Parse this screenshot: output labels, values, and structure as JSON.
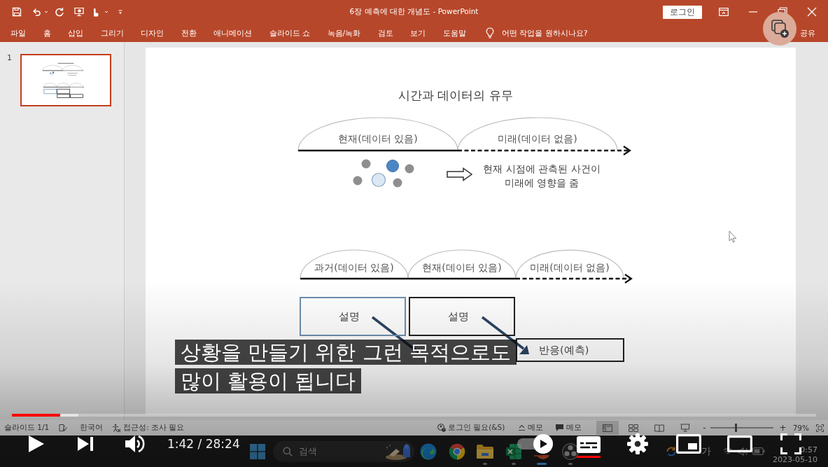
{
  "ppt": {
    "title": "6장 예측에 대한 개념도 - PowerPoint",
    "login_button": "로그인",
    "ribbon_tabs": [
      "파일",
      "홈",
      "삽입",
      "그리기",
      "디자인",
      "전환",
      "애니메이션",
      "슬라이드 쇼",
      "녹음/녹화",
      "검토",
      "보기",
      "도움말"
    ],
    "tell_me": "어떤 작업을 원하시나요?",
    "share": "공유",
    "thumbnails": [
      {
        "number": "1",
        "selected": true
      }
    ],
    "slide": {
      "title": "시간과 데이터의 유무",
      "timeline_top": {
        "segments": [
          {
            "label": "현재(데이터 있음)",
            "kind": "observed"
          },
          {
            "label": "미래(데이터 없음)",
            "kind": "future"
          }
        ],
        "note_lines": [
          "현재 시점에 관측된 사건이",
          "미래에 영향을 줌"
        ]
      },
      "timeline_bottom": {
        "segments": [
          {
            "label": "과거(데이터 있음)",
            "kind": "observed"
          },
          {
            "label": "현재(데이터 있음)",
            "kind": "observed"
          },
          {
            "label": "미래(데이터 없음)",
            "kind": "future"
          }
        ]
      },
      "explanation_boxes": [
        {
          "label": "설명",
          "kind": "highlighted"
        },
        {
          "label": "설명",
          "kind": "plain"
        }
      ],
      "response_box": "반응(예측)"
    },
    "status_bar": {
      "slide_counter": "슬라이드 1/1",
      "language": "한국어",
      "accessibility": "접근성: 조사 필요",
      "sign_in": "로그인 필요(&S)",
      "notes": "메모",
      "comments": "메모",
      "views": [
        {
          "kind": "normal",
          "selected": true
        },
        {
          "kind": "sorter",
          "selected": false
        },
        {
          "kind": "reading",
          "selected": false
        },
        {
          "kind": "show",
          "selected": false
        }
      ],
      "zoom_out": "-",
      "zoom_slider": {
        "level": 0.41
      },
      "zoom_in": "+",
      "zoom": "79%"
    }
  },
  "taskbar": {
    "search": {
      "placeholder": "검색"
    },
    "apps": [
      {
        "kind": "swirl",
        "running": false,
        "selected": false
      },
      {
        "kind": "wheel",
        "running": false,
        "selected": false
      },
      {
        "kind": "folder",
        "running": true,
        "selected": false
      },
      {
        "kind": "sheet",
        "running": true,
        "selected": false
      },
      {
        "kind": "slides",
        "running": true,
        "selected": true
      },
      {
        "kind": "aperture",
        "running": true,
        "selected": false
      }
    ],
    "ime": "가",
    "clock": "0:57",
    "date": "2023-05-10"
  },
  "subtitles": [
    "상황을 만들기 위한 그런 목적으로도",
    "많이 활용이 됩니다"
  ],
  "player": {
    "progress": {
      "level": 0.06
    },
    "buffer": {
      "level": 0.083
    },
    "time": "1:42 / 28:24",
    "autoplay": {
      "on": true
    },
    "captions": {
      "on": true
    }
  }
}
